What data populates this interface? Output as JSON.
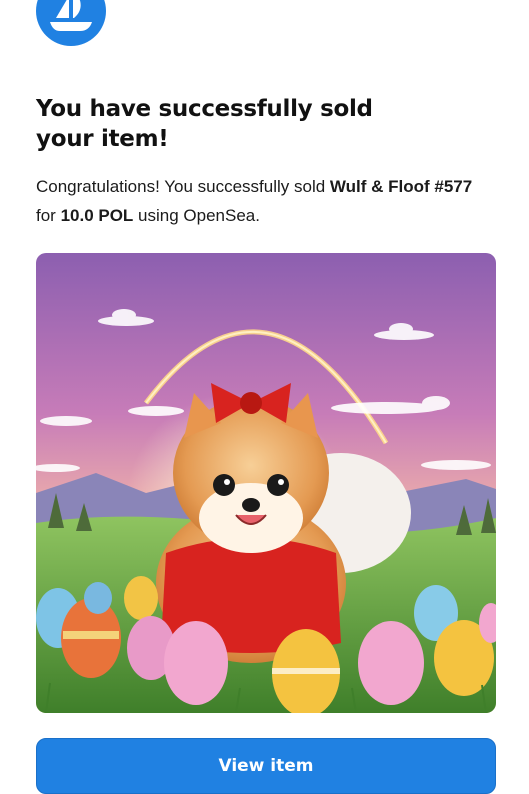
{
  "brand": {
    "logo_icon": "opensea-boat-icon",
    "accent_color": "#2081e2"
  },
  "heading": {
    "line1": "You have successfully sold",
    "line2": "your item!"
  },
  "message": {
    "prefix": "Congratulations! You successfully sold ",
    "item_name": "Wulf & Floof #577",
    "for_text": " for ",
    "price": "10.0 POL",
    "suffix": " using OpenSea."
  },
  "item_image": {
    "description_icon": "nft-artwork-image"
  },
  "actions": {
    "view_item_label": "View item"
  }
}
